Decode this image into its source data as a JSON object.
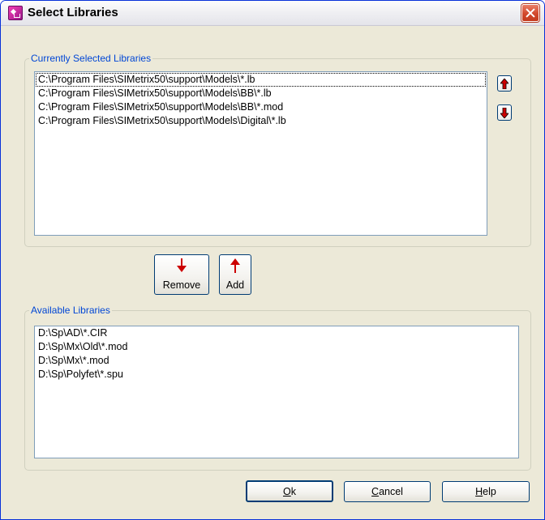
{
  "window": {
    "title": "Select Libraries"
  },
  "selected": {
    "legend": "Currently Selected Libraries",
    "items": [
      "C:\\Program Files\\SIMetrix50\\support\\Models\\*.lb",
      "C:\\Program Files\\SIMetrix50\\support\\Models\\BB\\*.lb",
      "C:\\Program Files\\SIMetrix50\\support\\Models\\BB\\*.mod",
      "C:\\Program Files\\SIMetrix50\\support\\Models\\Digital\\*.lb"
    ]
  },
  "buttons": {
    "move_up_icon": "arrow-up-icon",
    "move_down_icon": "arrow-down-icon",
    "remove": "Remove",
    "add": "Add",
    "ok_mnemonic": "O",
    "ok_rest": "k",
    "cancel_mnemonic": "C",
    "cancel_rest": "ancel",
    "help_mnemonic": "H",
    "help_rest": "elp"
  },
  "available": {
    "legend": "Available Libraries",
    "items": [
      "D:\\Sp\\AD\\*.CIR",
      "D:\\Sp\\Mx\\Old\\*.mod",
      "D:\\Sp\\Mx\\*.mod",
      "D:\\Sp\\Polyfet\\*.spu"
    ]
  },
  "colors": {
    "accent_arrow": "#cc0000",
    "legend_text": "#0046d5",
    "title_close": "#d2492c"
  }
}
